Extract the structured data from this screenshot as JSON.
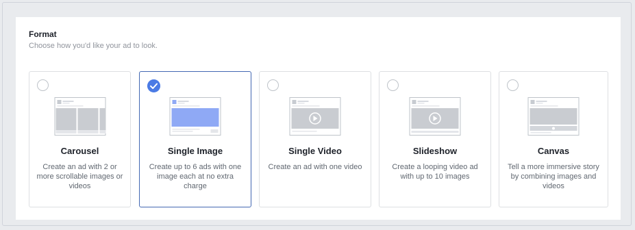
{
  "section": {
    "title": "Format",
    "subtitle": "Choose how you'd like your ad to look."
  },
  "formats": [
    {
      "title": "Carousel",
      "description": "Create an ad with 2 or more scrollable images or videos",
      "selected": false
    },
    {
      "title": "Single Image",
      "description": "Create up to 6 ads with one image each at no extra charge",
      "selected": true
    },
    {
      "title": "Single Video",
      "description": "Create an ad with one video",
      "selected": false
    },
    {
      "title": "Slideshow",
      "description": "Create a looping video ad with up to 10 images",
      "selected": false
    },
    {
      "title": "Canvas",
      "description": "Tell a more immersive story by combining images and videos",
      "selected": false
    }
  ],
  "colors": {
    "accent": "#4267b2",
    "check": "#4b7be5",
    "image_blue": "#8fa9f5"
  },
  "icons": [
    "radio-icon",
    "checkmark-icon",
    "carousel-thumbnail-icon",
    "single-image-thumbnail-icon",
    "video-thumbnail-icon",
    "slideshow-thumbnail-icon",
    "canvas-thumbnail-icon",
    "play-icon"
  ]
}
